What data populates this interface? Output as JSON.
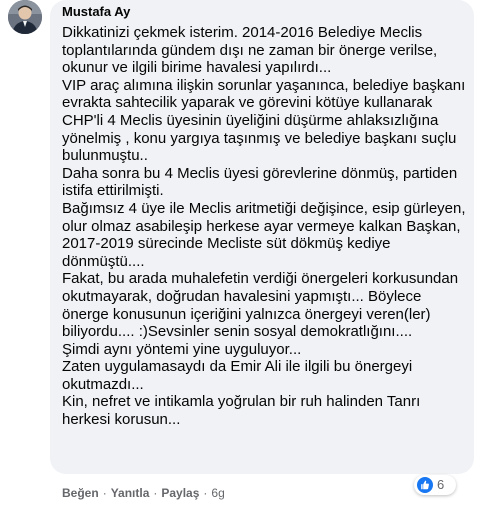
{
  "comment": {
    "author": "Mustafa Ay",
    "paragraphs": [
      "Dikkatinizi çekmek isterim. 2014-2016 Belediye Meclis toplantılarında gündem dışı ne zaman bir önerge verilse, okunur ve ilgili birime havalesi yapılırdı...",
      "VIP araç alımına ilişkin sorunlar yaşanınca, belediye başkanı evrakta sahtecilik yaparak ve görevini kötüye kullanarak CHP'li 4 Meclis üyesinin üyeliğini düşürme ahlaksızlığına yönelmiş , konu yargıya taşınmış ve belediye başkanı suçlu bulunmuştu..",
      "Daha sonra bu 4 Meclis üyesi görevlerine dönmüş, partiden istifa ettirilmişti.",
      "Bağımsız 4 üye ile Meclis aritmetiği değişince, esip gürleyen, olur olmaz asabileşip herkese ayar vermeye kalkan Başkan, 2017-2019 sürecinde Mecliste süt dökmüş kediye dönmüştü....",
      "Fakat, bu arada muhalefetin verdiği önergeleri korkusundan okutmayarak, doğrudan havalesini yapmıştı... Böylece önerge konusunun içeriğini yalnızca önergeyi veren(ler) biliyordu.... :)Sevsinler senin sosyal demokratlığını....",
      "Şimdi aynı yöntemi yine uyguluyor...",
      "Zaten uygulamasaydı da Emir Ali ile ilgili bu önergeyi okutmazdı...",
      "Kin, nefret ve intikamla yoğrulan bir ruh halinden Tanrı herkesi korusun..."
    ],
    "reaction": {
      "icon": "thumbs-up-icon",
      "count": "6",
      "color": "#1877f2"
    },
    "actions": {
      "like": "Beğen",
      "reply": "Yanıtla",
      "share": "Paylaş",
      "separator": "·",
      "time": "6g"
    }
  }
}
